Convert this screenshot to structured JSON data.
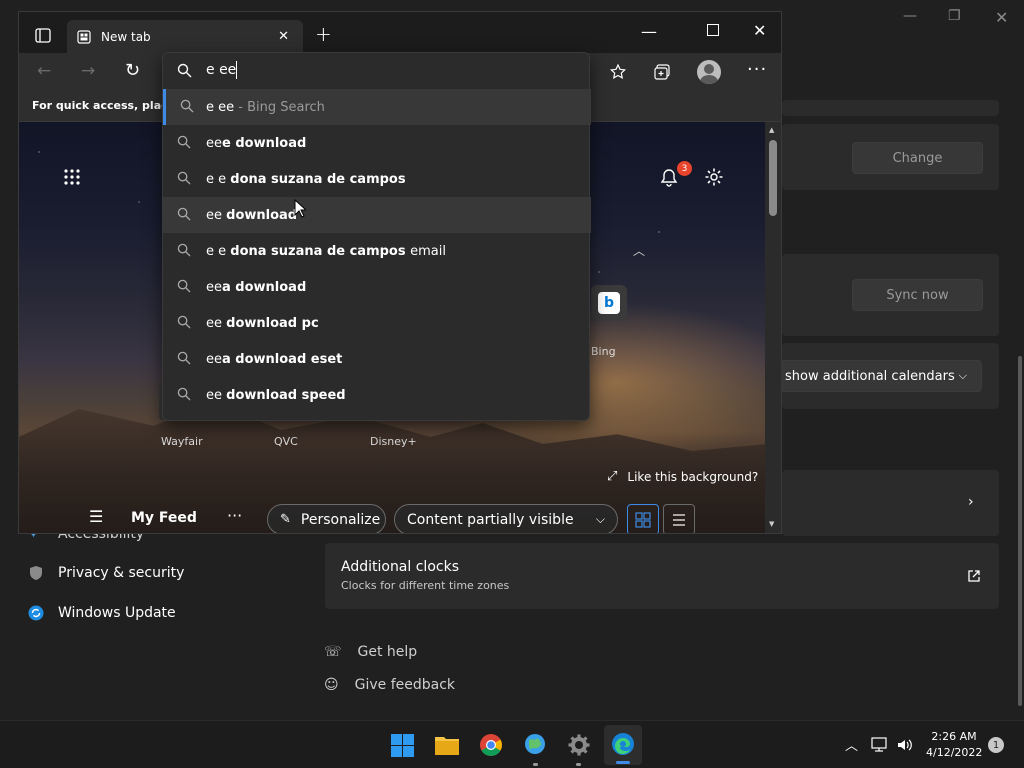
{
  "settings": {
    "change_label": "Change",
    "sync_label": "Sync now",
    "calendars_label": "show additional calendars",
    "clocks_title": "Additional clocks",
    "clocks_sub": "Clocks for different time zones",
    "sidebar": [
      {
        "label": "Accessibility",
        "icon": "accessibility-icon"
      },
      {
        "label": "Privacy & security",
        "icon": "shield-icon"
      },
      {
        "label": "Windows Update",
        "icon": "update-icon"
      }
    ],
    "help_label": "Get help",
    "feedback_label": "Give feedback"
  },
  "browser": {
    "tab_title": "New tab",
    "fav_hint": "For quick access, place y",
    "address_value": "e ee",
    "suggestions": [
      {
        "pre": "e ee",
        "bold": "",
        "suffix": " - Bing Search"
      },
      {
        "pre": "ee",
        "bold": "e download",
        "suffix": ""
      },
      {
        "pre": "e e ",
        "bold": "dona suzana de campos",
        "suffix": ""
      },
      {
        "pre": "ee ",
        "bold": "download",
        "suffix": ""
      },
      {
        "pre": "e e ",
        "bold": "dona suzana de campos ",
        "suffix": "email"
      },
      {
        "pre": "ee",
        "bold": "a download",
        "suffix": ""
      },
      {
        "pre": "ee ",
        "bold": "download pc",
        "suffix": ""
      },
      {
        "pre": "ee",
        "bold": "a download eset",
        "suffix": ""
      },
      {
        "pre": "ee ",
        "bold": "download speed",
        "suffix": ""
      }
    ],
    "notif_count": "3",
    "bing_label": "Bing",
    "tiles": [
      "Wayfair",
      "QVC",
      "Disney+"
    ],
    "like_bg": "Like this background?",
    "my_feed": "My Feed",
    "personalize": "Personalize",
    "content_visible": "Content partially visible"
  },
  "taskbar": {
    "time": "2:26 AM",
    "date": "4/12/2022",
    "notif_badge": "1"
  },
  "colors": {
    "accent": "#0078d4",
    "badge": "#e8452c"
  }
}
